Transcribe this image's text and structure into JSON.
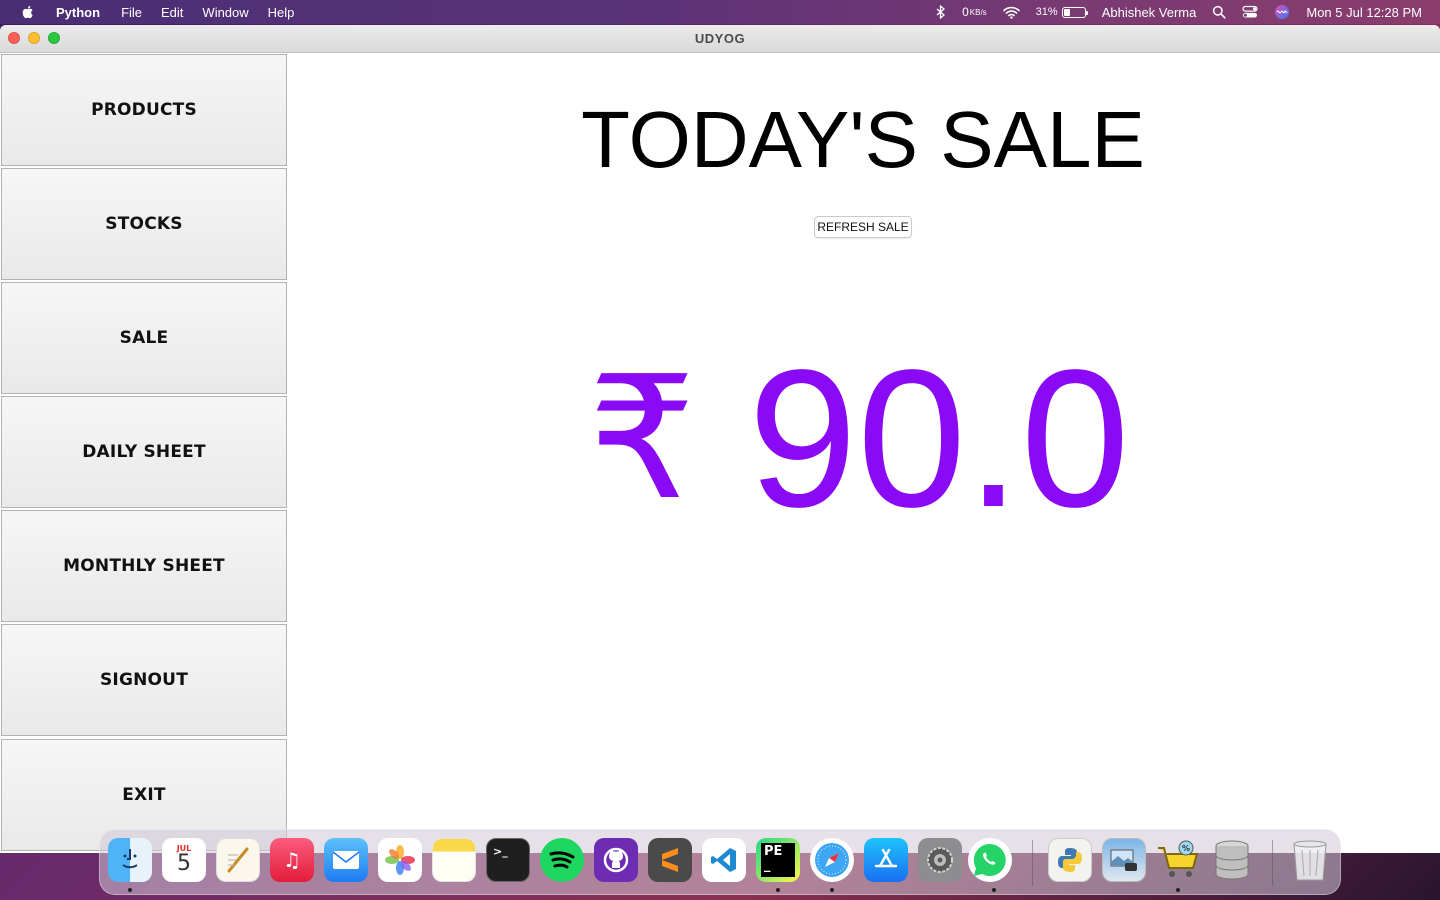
{
  "menubar": {
    "app_name": "Python",
    "menus": [
      "File",
      "Edit",
      "Window",
      "Help"
    ],
    "net_speed": "0",
    "net_unit": "KB/s",
    "battery_percent": "31%",
    "battery_level": 0.31,
    "user": "Abhishek Verma",
    "datetime": "Mon 5 Jul  12:28 PM"
  },
  "window": {
    "title": "UDYOG"
  },
  "sidebar": {
    "items": [
      {
        "label": "PRODUCTS"
      },
      {
        "label": "STOCKS"
      },
      {
        "label": "SALE"
      },
      {
        "label": "DAILY SHEET"
      },
      {
        "label": "MONTHLY SHEET"
      },
      {
        "label": "SIGNOUT"
      },
      {
        "label": "EXIT"
      }
    ]
  },
  "main": {
    "title": "TODAY'S SALE",
    "refresh_label": "REFRESH SALE",
    "currency_symbol": "₹",
    "amount": "90.0",
    "amount_color": "#8a0af5"
  },
  "dock": {
    "calendar_month": "JUL",
    "calendar_day": "5",
    "apps": [
      "finder-icon",
      "calendar-icon",
      "textedit-icon",
      "music-icon",
      "mail-icon",
      "photos-icon",
      "notes-icon",
      "terminal-icon",
      "spotify-icon",
      "github-desktop-icon",
      "sublime-text-icon",
      "vscode-icon",
      "pycharm-icon",
      "safari-icon",
      "app-store-icon",
      "system-preferences-icon",
      "whatsapp-icon",
      "python-launcher-icon",
      "preview-icon",
      "shop-cart-app-icon",
      "database-app-icon",
      "trash-icon"
    ]
  }
}
